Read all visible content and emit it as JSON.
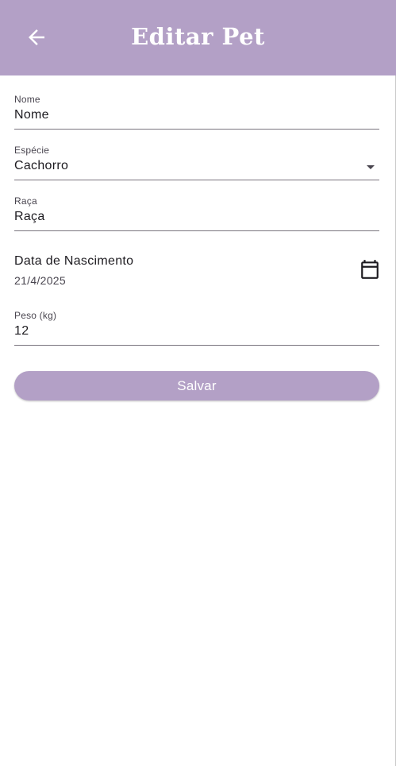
{
  "app_bar": {
    "title": "Editar Pet",
    "back_icon": "arrow-left-icon",
    "background_color": "#b3a0c6"
  },
  "form": {
    "nome": {
      "label": "Nome",
      "value": "Nome"
    },
    "especie": {
      "label": "Espécie",
      "value": "Cachorro",
      "icon": "dropdown-arrow-icon"
    },
    "raca": {
      "label": "Raça",
      "value": "Raça"
    },
    "data_nascimento": {
      "label": "Data de Nascimento",
      "value": "21/4/2025",
      "icon": "calendar-icon"
    },
    "peso": {
      "label": "Peso (kg)",
      "value": "12"
    }
  },
  "actions": {
    "save_label": "Salvar",
    "save_color": "#b3a0c6"
  }
}
